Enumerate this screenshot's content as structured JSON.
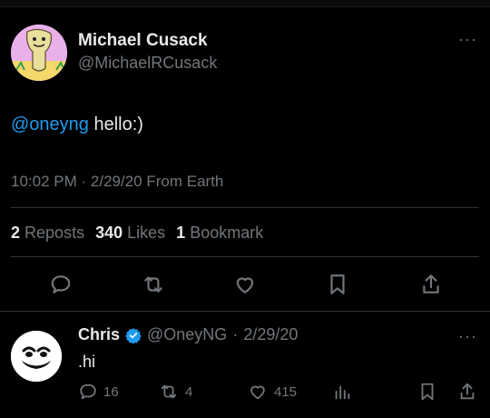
{
  "tweet": {
    "author_name": "Michael Cusack",
    "author_handle": "@MichaelRCusack",
    "more_label": "···",
    "text_mention": "@oneyng",
    "text_body": " hello:)",
    "time": "10:02 PM",
    "date": "2/29/20",
    "source": "From Earth",
    "dot": "·",
    "stats": {
      "reposts_count": "2",
      "reposts_label": "Reposts",
      "likes_count": "340",
      "likes_label": "Likes",
      "bookmarks_count": "1",
      "bookmarks_label": "Bookmark"
    },
    "action_icons": [
      "reply-icon",
      "repost-icon",
      "like-icon",
      "bookmark-icon",
      "share-icon"
    ]
  },
  "reply": {
    "author_name": "Chris",
    "author_handle": "@OneyNG",
    "date": "2/29/20",
    "dot": "·",
    "more_label": "···",
    "text": ".hi",
    "replies": "16",
    "reposts": "4",
    "likes": "415"
  },
  "colors": {
    "accent": "#1d9bf0",
    "text": "#e7e9ea",
    "muted": "#71767b",
    "background": "#000000",
    "verified": "#1d9bf0"
  }
}
